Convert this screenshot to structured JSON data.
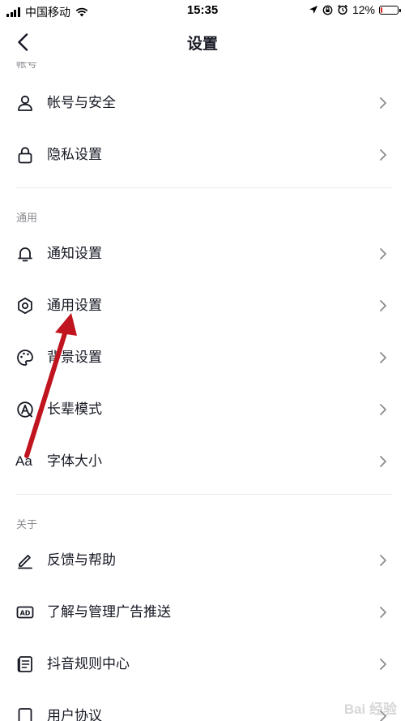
{
  "status_bar": {
    "carrier": "中国移动",
    "time": "15:35",
    "battery_percent": "12%",
    "battery_level": 0.12,
    "battery_color": "#e02020",
    "icons": [
      "signal-icon",
      "wifi-icon",
      "location-icon",
      "rotation-lock-icon",
      "alarm-icon",
      "battery-icon"
    ]
  },
  "nav": {
    "back_icon": "chevron-left-icon",
    "title": "设置"
  },
  "sections": {
    "account": {
      "header": "帐号",
      "items": [
        {
          "label": "帐号与安全",
          "icon": "person-icon"
        },
        {
          "label": "隐私设置",
          "icon": "lock-icon"
        }
      ]
    },
    "general": {
      "header": "通用",
      "items": [
        {
          "label": "通知设置",
          "icon": "bell-icon"
        },
        {
          "label": "通用设置",
          "icon": "gear-icon"
        },
        {
          "label": "背景设置",
          "icon": "palette-icon"
        },
        {
          "label": "长辈模式",
          "icon": "elder-mode-icon"
        },
        {
          "label": "字体大小",
          "icon": "font-size-icon",
          "icon_text": "Aa"
        }
      ]
    },
    "about": {
      "header": "关于",
      "items": [
        {
          "label": "反馈与帮助",
          "icon": "pencil-icon"
        },
        {
          "label": "了解与管理广告推送",
          "icon": "ad-icon",
          "icon_text": "AD"
        },
        {
          "label": "抖音规则中心",
          "icon": "document-icon"
        },
        {
          "label": "用户协议",
          "icon": "agreement-icon"
        }
      ]
    }
  },
  "annotation": {
    "color": "#c0151f",
    "points_to": "通用设置"
  },
  "watermark": "Bai 经验"
}
